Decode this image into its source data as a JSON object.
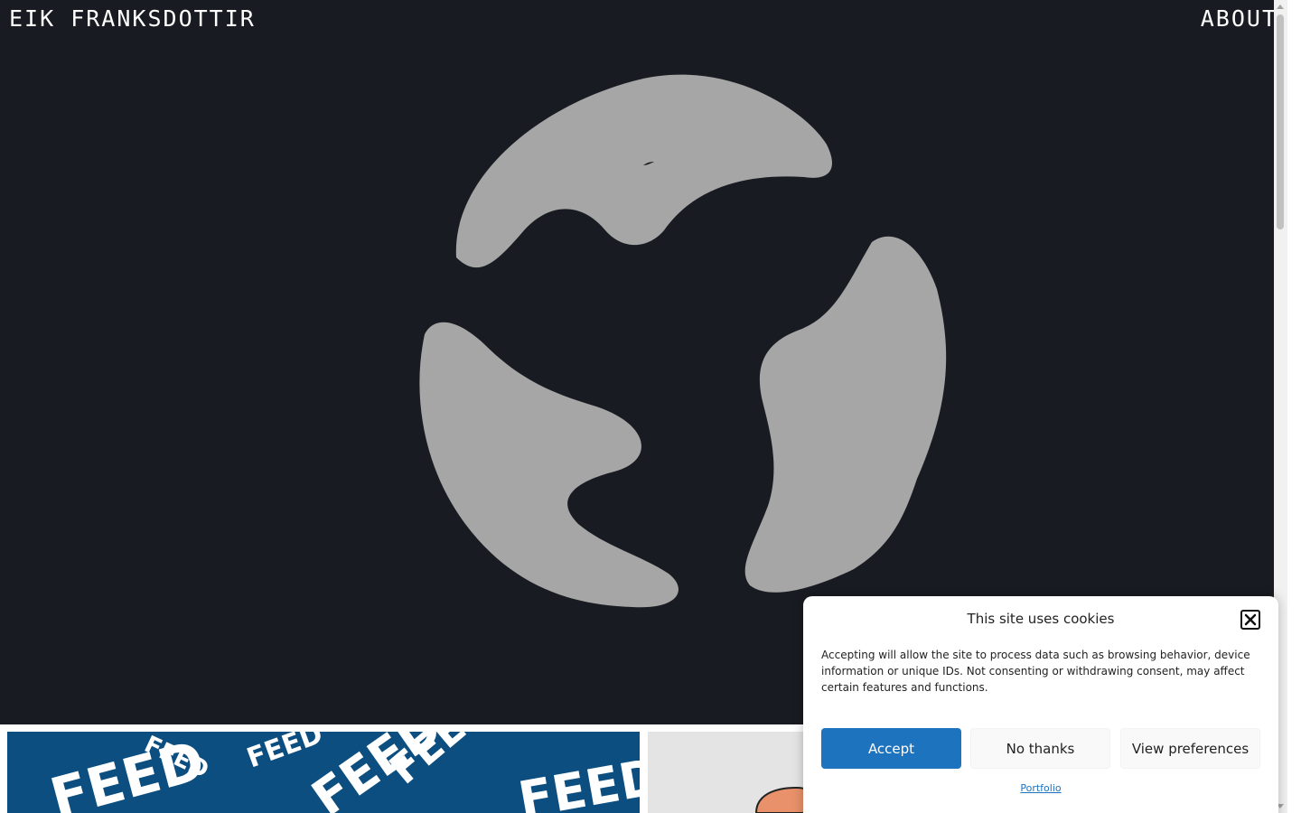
{
  "header": {
    "site_title": "EIK FRANKSDOTTIR",
    "about_label": "ABOUT"
  },
  "hero": {
    "background_color": "#181b21",
    "shape_color": "#a6a6a6",
    "logo_icon": "three-blob-circle-logo-icon"
  },
  "gallery": {
    "cards": [
      {
        "name": "blue-typography-poster",
        "color": "#0b4e7f",
        "poster_text": "FEED"
      },
      {
        "name": "gray-illustration-card",
        "color": "#e4e4e4"
      }
    ]
  },
  "cookie_banner": {
    "title": "This site uses cookies",
    "text": "Accepting will allow the site to process data such as browsing behavior, device information or unique IDs. Not consenting or withdrawing consent, may affect certain features and functions.",
    "accept_label": "Accept",
    "deny_label": "No thanks",
    "preferences_label": "View preferences",
    "policy_link": "Portfolio",
    "accent_color": "#1e73be"
  }
}
